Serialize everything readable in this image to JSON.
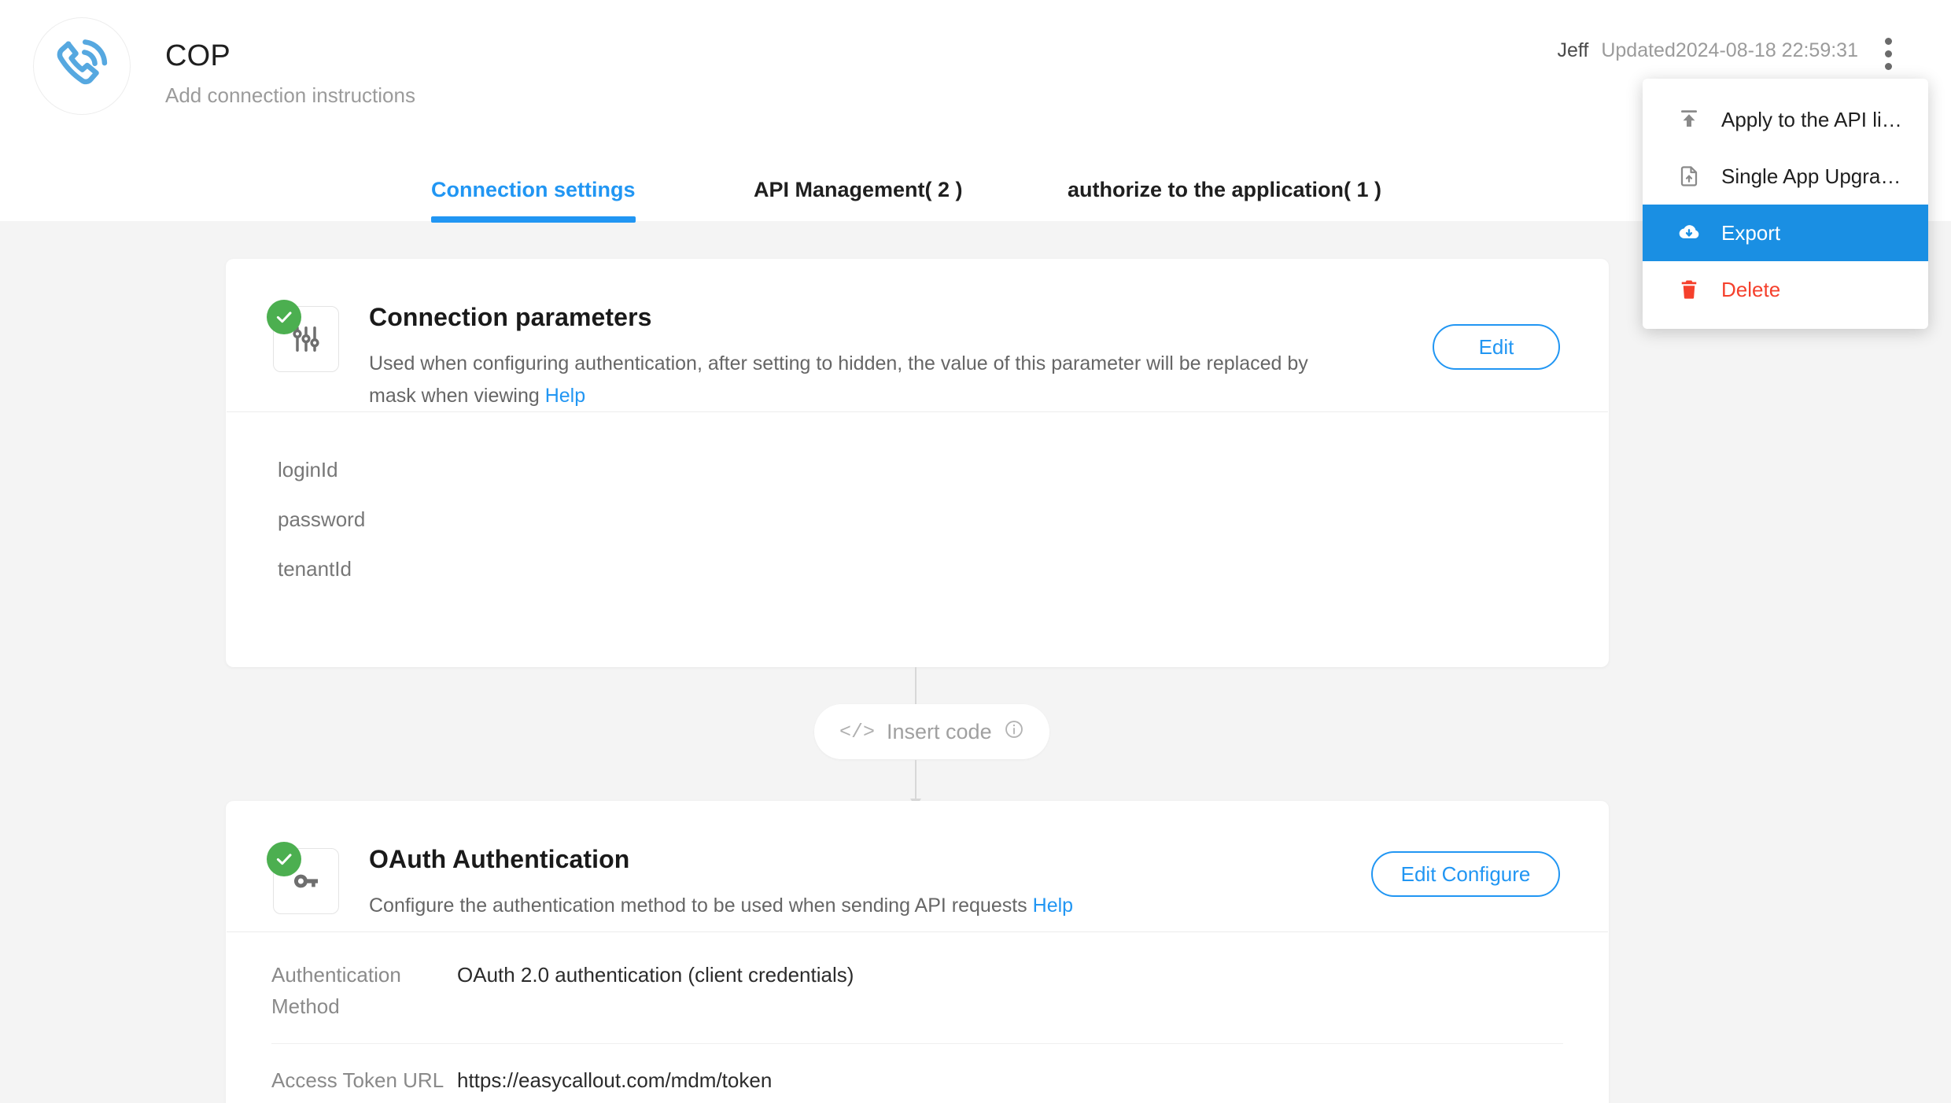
{
  "header": {
    "logo_icon": "phone-call-icon",
    "title": "COP",
    "subtitle": "Add connection instructions",
    "user": "Jeff",
    "updated": "Updated2024-08-18 22:59:31",
    "kebab_icon": "more-vertical-icon"
  },
  "tabs": [
    {
      "label": "Connection settings",
      "active": true
    },
    {
      "label": "API Management( 2 )",
      "active": false
    },
    {
      "label": "authorize to the application( 1 )",
      "active": false
    }
  ],
  "menu": {
    "items": [
      {
        "label": "Apply to the API li…",
        "icon": "upload-icon",
        "state": "normal"
      },
      {
        "label": "Single App Upgra…",
        "icon": "file-upload-icon",
        "state": "normal"
      },
      {
        "label": "Export",
        "icon": "cloud-download-icon",
        "state": "highlight"
      },
      {
        "label": "Delete",
        "icon": "trash-icon",
        "state": "danger"
      }
    ],
    "highlight_color": "#1a8fe3",
    "danger_color": "#f5402c"
  },
  "connection_card": {
    "status_icon": "check-circle-icon",
    "tile_icon": "sliders-icon",
    "title": "Connection parameters",
    "description": "Used when configuring authentication, after setting to hidden, the value of this parameter will be replaced by mask when viewing",
    "help_label": "Help",
    "edit_button": "Edit",
    "parameters": [
      "loginId",
      "password",
      "tenantId"
    ]
  },
  "connector": {
    "insert_code_label": "Insert code",
    "code_glyph": "</>",
    "info_icon": "info-circle-icon"
  },
  "oauth_card": {
    "status_icon": "check-circle-icon",
    "tile_icon": "key-icon",
    "title": "OAuth Authentication",
    "description": "Configure the authentication method to be used when sending API requests",
    "help_label": "Help",
    "edit_button": "Edit Configure",
    "details": [
      {
        "key": "Authentication Method",
        "value": "OAuth 2.0 authentication (client credentials)"
      },
      {
        "key": "Access Token URL",
        "value": "https://easycallout.com/mdm/token"
      }
    ]
  },
  "colors": {
    "accent": "#2196f3",
    "success": "#4caf50",
    "danger": "#f5402c",
    "page_bg": "#f4f4f4"
  }
}
